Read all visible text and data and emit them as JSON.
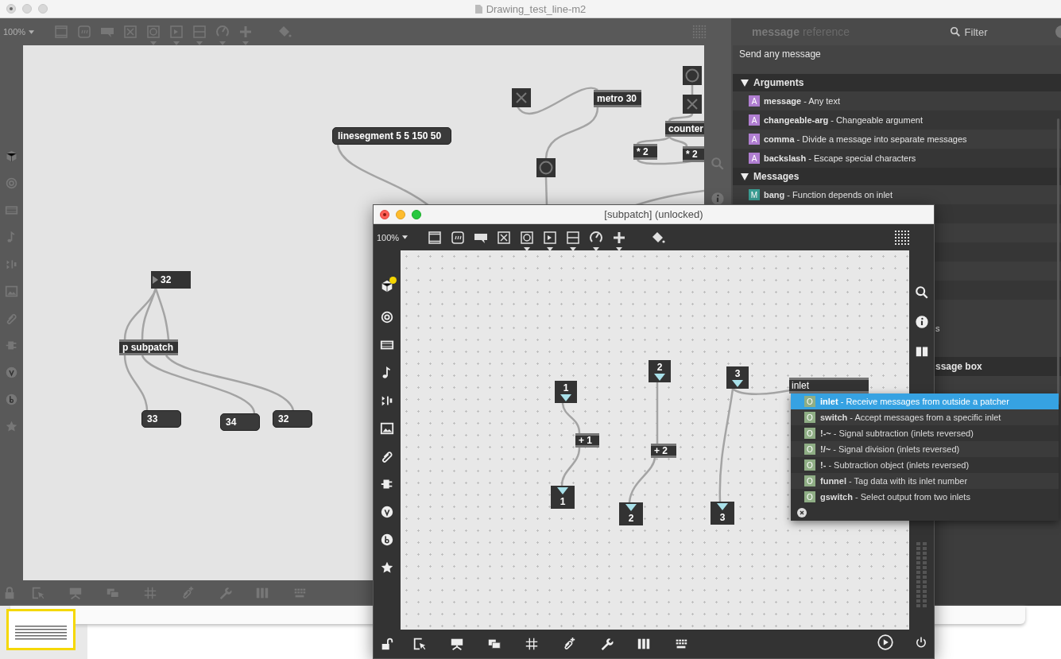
{
  "main_window": {
    "title": "Drawing_test_line-m2",
    "zoom": "100%",
    "objects": [
      {
        "kind": "toggle"
      },
      {
        "kind": "object",
        "text": "metro 30"
      },
      {
        "kind": "button"
      },
      {
        "kind": "toggle"
      },
      {
        "kind": "object",
        "text": "counter"
      },
      {
        "kind": "message",
        "text": "linesegment 5 5 150 50"
      },
      {
        "kind": "object",
        "text": "* 2"
      },
      {
        "kind": "object",
        "text": "* 2"
      },
      {
        "kind": "button"
      },
      {
        "kind": "number",
        "text": "32"
      },
      {
        "kind": "object",
        "text": "p subpatch"
      },
      {
        "kind": "message",
        "text": "33"
      },
      {
        "kind": "message",
        "text": "34"
      },
      {
        "kind": "message",
        "text": "32"
      }
    ]
  },
  "reference": {
    "title": "message",
    "subtitle": "reference",
    "filter": "Filter",
    "description": "Send any message",
    "sections": [
      {
        "title": "Arguments",
        "expanded": true,
        "items": [
          {
            "kind": "argument",
            "badge": "A",
            "text": "**message** - Any text"
          },
          {
            "kind": "argument",
            "badge": "A",
            "text": "**changeable-arg** - Changeable argument"
          },
          {
            "kind": "argument",
            "badge": "A",
            "text": "**comma** - Divide a message into separate messages"
          },
          {
            "kind": "argument",
            "badge": "A",
            "text": "**backslash** - Escape special characters"
          }
        ]
      },
      {
        "title": "Messages",
        "expanded": true,
        "items": [
          {
            "kind": "message",
            "badge": "M",
            "text": "**bang** - Function depends on inlet"
          }
        ]
      }
    ],
    "covered_rows": [
      {
        "text": "s"
      },
      {
        "text": "ssage box"
      }
    ]
  },
  "subpatch_window": {
    "title": "[subpatch] (unlocked)",
    "zoom": "100%",
    "objects": [
      {
        "kind": "inlet",
        "text": "1"
      },
      {
        "kind": "inlet",
        "text": "2"
      },
      {
        "kind": "inlet",
        "text": "3"
      },
      {
        "kind": "object",
        "text": "+ 1"
      },
      {
        "kind": "object",
        "text": "+ 2"
      },
      {
        "kind": "outlet",
        "text": "1"
      },
      {
        "kind": "outlet",
        "text": "2"
      },
      {
        "kind": "outlet",
        "text": "3"
      }
    ],
    "new_object": {
      "value": "inlet"
    },
    "autocomplete": [
      {
        "badge": "O",
        "text": "**inlet** - Receive messages from outside a patcher",
        "selected": true
      },
      {
        "badge": "O",
        "text": "**switch** - Accept messages from a specific inlet",
        "selected": false
      },
      {
        "badge": "O",
        "text": "**!-~** - Signal subtraction (inlets reversed)",
        "selected": false
      },
      {
        "badge": "O",
        "text": "**!/~** - Signal division (inlets reversed)",
        "selected": false
      },
      {
        "badge": "O",
        "text": "**!-** - Subtraction object (inlets reversed)",
        "selected": false
      },
      {
        "badge": "O",
        "text": "**funnel** - Tag data with its inlet number",
        "selected": false
      },
      {
        "badge": "O",
        "text": "**gswitch** - Select output from two inlets",
        "selected": false
      }
    ]
  }
}
